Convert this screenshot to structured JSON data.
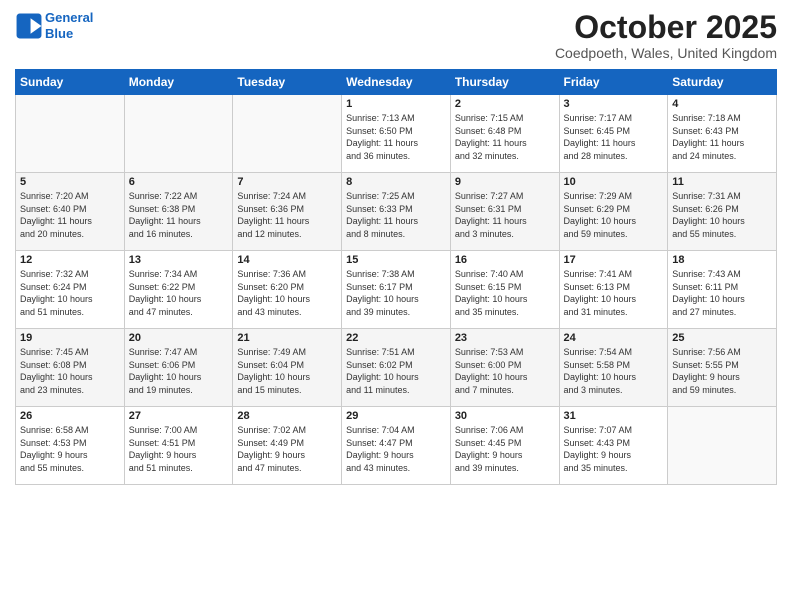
{
  "logo": {
    "line1": "General",
    "line2": "Blue"
  },
  "title": "October 2025",
  "location": "Coedpoeth, Wales, United Kingdom",
  "weekdays": [
    "Sunday",
    "Monday",
    "Tuesday",
    "Wednesday",
    "Thursday",
    "Friday",
    "Saturday"
  ],
  "weeks": [
    [
      {
        "day": "",
        "info": ""
      },
      {
        "day": "",
        "info": ""
      },
      {
        "day": "",
        "info": ""
      },
      {
        "day": "1",
        "info": "Sunrise: 7:13 AM\nSunset: 6:50 PM\nDaylight: 11 hours\nand 36 minutes."
      },
      {
        "day": "2",
        "info": "Sunrise: 7:15 AM\nSunset: 6:48 PM\nDaylight: 11 hours\nand 32 minutes."
      },
      {
        "day": "3",
        "info": "Sunrise: 7:17 AM\nSunset: 6:45 PM\nDaylight: 11 hours\nand 28 minutes."
      },
      {
        "day": "4",
        "info": "Sunrise: 7:18 AM\nSunset: 6:43 PM\nDaylight: 11 hours\nand 24 minutes."
      }
    ],
    [
      {
        "day": "5",
        "info": "Sunrise: 7:20 AM\nSunset: 6:40 PM\nDaylight: 11 hours\nand 20 minutes."
      },
      {
        "day": "6",
        "info": "Sunrise: 7:22 AM\nSunset: 6:38 PM\nDaylight: 11 hours\nand 16 minutes."
      },
      {
        "day": "7",
        "info": "Sunrise: 7:24 AM\nSunset: 6:36 PM\nDaylight: 11 hours\nand 12 minutes."
      },
      {
        "day": "8",
        "info": "Sunrise: 7:25 AM\nSunset: 6:33 PM\nDaylight: 11 hours\nand 8 minutes."
      },
      {
        "day": "9",
        "info": "Sunrise: 7:27 AM\nSunset: 6:31 PM\nDaylight: 11 hours\nand 3 minutes."
      },
      {
        "day": "10",
        "info": "Sunrise: 7:29 AM\nSunset: 6:29 PM\nDaylight: 10 hours\nand 59 minutes."
      },
      {
        "day": "11",
        "info": "Sunrise: 7:31 AM\nSunset: 6:26 PM\nDaylight: 10 hours\nand 55 minutes."
      }
    ],
    [
      {
        "day": "12",
        "info": "Sunrise: 7:32 AM\nSunset: 6:24 PM\nDaylight: 10 hours\nand 51 minutes."
      },
      {
        "day": "13",
        "info": "Sunrise: 7:34 AM\nSunset: 6:22 PM\nDaylight: 10 hours\nand 47 minutes."
      },
      {
        "day": "14",
        "info": "Sunrise: 7:36 AM\nSunset: 6:20 PM\nDaylight: 10 hours\nand 43 minutes."
      },
      {
        "day": "15",
        "info": "Sunrise: 7:38 AM\nSunset: 6:17 PM\nDaylight: 10 hours\nand 39 minutes."
      },
      {
        "day": "16",
        "info": "Sunrise: 7:40 AM\nSunset: 6:15 PM\nDaylight: 10 hours\nand 35 minutes."
      },
      {
        "day": "17",
        "info": "Sunrise: 7:41 AM\nSunset: 6:13 PM\nDaylight: 10 hours\nand 31 minutes."
      },
      {
        "day": "18",
        "info": "Sunrise: 7:43 AM\nSunset: 6:11 PM\nDaylight: 10 hours\nand 27 minutes."
      }
    ],
    [
      {
        "day": "19",
        "info": "Sunrise: 7:45 AM\nSunset: 6:08 PM\nDaylight: 10 hours\nand 23 minutes."
      },
      {
        "day": "20",
        "info": "Sunrise: 7:47 AM\nSunset: 6:06 PM\nDaylight: 10 hours\nand 19 minutes."
      },
      {
        "day": "21",
        "info": "Sunrise: 7:49 AM\nSunset: 6:04 PM\nDaylight: 10 hours\nand 15 minutes."
      },
      {
        "day": "22",
        "info": "Sunrise: 7:51 AM\nSunset: 6:02 PM\nDaylight: 10 hours\nand 11 minutes."
      },
      {
        "day": "23",
        "info": "Sunrise: 7:53 AM\nSunset: 6:00 PM\nDaylight: 10 hours\nand 7 minutes."
      },
      {
        "day": "24",
        "info": "Sunrise: 7:54 AM\nSunset: 5:58 PM\nDaylight: 10 hours\nand 3 minutes."
      },
      {
        "day": "25",
        "info": "Sunrise: 7:56 AM\nSunset: 5:55 PM\nDaylight: 9 hours\nand 59 minutes."
      }
    ],
    [
      {
        "day": "26",
        "info": "Sunrise: 6:58 AM\nSunset: 4:53 PM\nDaylight: 9 hours\nand 55 minutes."
      },
      {
        "day": "27",
        "info": "Sunrise: 7:00 AM\nSunset: 4:51 PM\nDaylight: 9 hours\nand 51 minutes."
      },
      {
        "day": "28",
        "info": "Sunrise: 7:02 AM\nSunset: 4:49 PM\nDaylight: 9 hours\nand 47 minutes."
      },
      {
        "day": "29",
        "info": "Sunrise: 7:04 AM\nSunset: 4:47 PM\nDaylight: 9 hours\nand 43 minutes."
      },
      {
        "day": "30",
        "info": "Sunrise: 7:06 AM\nSunset: 4:45 PM\nDaylight: 9 hours\nand 39 minutes."
      },
      {
        "day": "31",
        "info": "Sunrise: 7:07 AM\nSunset: 4:43 PM\nDaylight: 9 hours\nand 35 minutes."
      },
      {
        "day": "",
        "info": ""
      }
    ]
  ]
}
